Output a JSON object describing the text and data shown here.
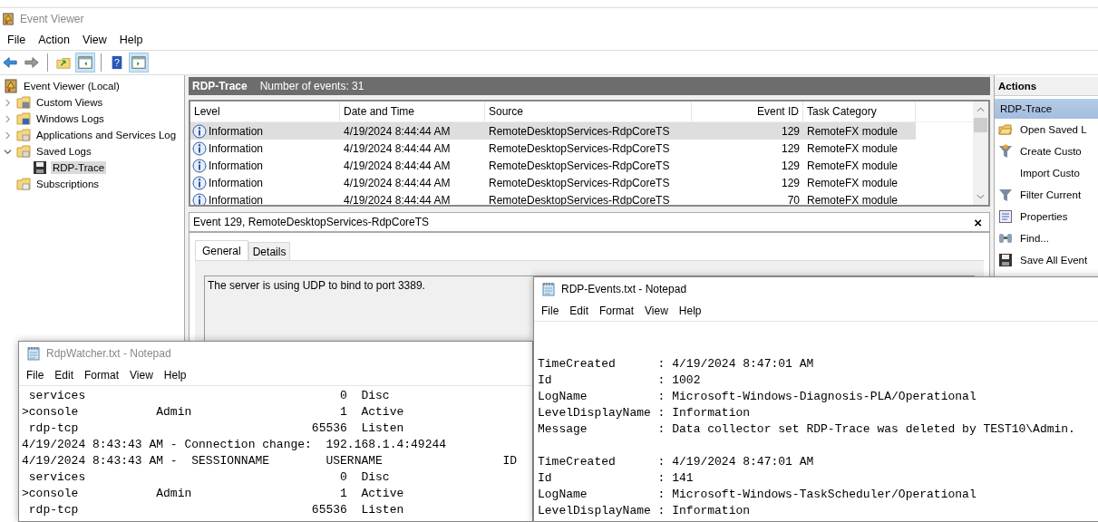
{
  "window": {
    "title": "Event Viewer"
  },
  "menu": [
    "File",
    "Action",
    "View",
    "Help"
  ],
  "toolbar": [
    {
      "kind": "back",
      "pressed": false
    },
    {
      "kind": "forward",
      "pressed": false
    },
    {
      "kind": "up-folder",
      "pressed": false
    },
    {
      "kind": "pane-left",
      "pressed": true
    },
    {
      "kind": "help",
      "pressed": false,
      "label": "?"
    },
    {
      "kind": "pane-right",
      "pressed": true
    }
  ],
  "tree": {
    "label": "Event Viewer (Local)",
    "kind": "root",
    "selected": false,
    "children": [
      {
        "label": "Custom Views",
        "kind": "folder-filter",
        "expanded": false,
        "selected": false
      },
      {
        "label": "Windows Logs",
        "kind": "folder-windows",
        "expanded": false,
        "selected": false
      },
      {
        "label": "Applications and Services Log",
        "kind": "folder-app",
        "expanded": false,
        "selected": false
      },
      {
        "label": "Saved Logs",
        "kind": "folder-log",
        "expanded": true,
        "selected": false,
        "children": [
          {
            "label": "RDP-Trace",
            "kind": "disk",
            "selected": true
          }
        ]
      },
      {
        "label": "Subscriptions",
        "kind": "folder-calendar",
        "selected": false
      }
    ]
  },
  "log_header": {
    "title": "RDP-Trace",
    "count": "Number of events: 31"
  },
  "table": {
    "columns": [
      "Level",
      "Date and Time",
      "Source",
      "Event ID",
      "Task Category"
    ],
    "rows": [
      {
        "selected": true,
        "cells": [
          "Information",
          "4/19/2024 8:44:44 AM",
          "RemoteDesktopServices-RdpCoreTS",
          "129",
          "RemoteFX module"
        ]
      },
      {
        "selected": false,
        "cells": [
          "Information",
          "4/19/2024 8:44:44 AM",
          "RemoteDesktopServices-RdpCoreTS",
          "129",
          "RemoteFX module"
        ]
      },
      {
        "selected": false,
        "cells": [
          "Information",
          "4/19/2024 8:44:44 AM",
          "RemoteDesktopServices-RdpCoreTS",
          "129",
          "RemoteFX module"
        ]
      },
      {
        "selected": false,
        "cells": [
          "Information",
          "4/19/2024 8:44:44 AM",
          "RemoteDesktopServices-RdpCoreTS",
          "129",
          "RemoteFX module"
        ]
      },
      {
        "selected": false,
        "cells": [
          "Information",
          "4/19/2024 8:44:44 AM",
          "RemoteDesktopServices-RdpCoreTS",
          "70",
          "RemoteFX module"
        ]
      }
    ]
  },
  "detail": {
    "title": "Event 129, RemoteDesktopServices-RdpCoreTS",
    "close": "×",
    "tabs": [
      {
        "label": "General",
        "selected": true
      },
      {
        "label": "Details",
        "selected": false
      }
    ],
    "message": "The server is using UDP to bind to port 3389."
  },
  "actions": {
    "title": "Actions",
    "items": [
      {
        "label": "RDP-Trace",
        "kind": "section",
        "selected": true
      },
      {
        "label": "Open Saved L",
        "kind": "open-folder",
        "selected": false
      },
      {
        "label": "Create Custo",
        "kind": "filter-star",
        "selected": false
      },
      {
        "label": "Import Custo",
        "kind": "none",
        "selected": false
      },
      {
        "label": "Filter Current",
        "kind": "filter",
        "selected": false
      },
      {
        "label": "Properties",
        "kind": "properties",
        "selected": false
      },
      {
        "label": "Find...",
        "kind": "binoculars",
        "selected": false
      },
      {
        "label": "Save All Event",
        "kind": "disk",
        "selected": false
      }
    ]
  },
  "notepads": [
    {
      "title": "RdpWatcher.txt - Notepad",
      "menu": [
        "File",
        "Edit",
        "Format",
        "View",
        "Help"
      ],
      "paragraphs": [
        [
          " services                                    0  Disc",
          ">console           Admin                     1  Active",
          " rdp-tcp                                 65536  Listen",
          "4/19/2024 8:43:43 AM - Connection change:  192.168.1.4:49244",
          "4/19/2024 8:43:43 AM -  SESSIONNAME        USERNAME                 ID",
          " services                                    0  Disc",
          ">console           Admin                     1  Active",
          " rdp-tcp                                 65536  Listen"
        ]
      ]
    },
    {
      "title": "RDP-Events.txt - Notepad",
      "menu": [
        "File",
        "Edit",
        "Format",
        "View",
        "Help"
      ],
      "paragraphs": [
        [
          "TimeCreated      : 4/19/2024 8:47:01 AM",
          "Id               : 1002",
          "LogName          : Microsoft-Windows-Diagnosis-PLA/Operational",
          "LevelDisplayName : Information",
          "Message          : Data collector set RDP-Trace was deleted by TEST10\\Admin."
        ],
        [
          "TimeCreated      : 4/19/2024 8:47:01 AM",
          "Id               : 141",
          "LogName          : Microsoft-Windows-TaskScheduler/Operational",
          "LevelDisplayName : Information"
        ]
      ]
    }
  ]
}
